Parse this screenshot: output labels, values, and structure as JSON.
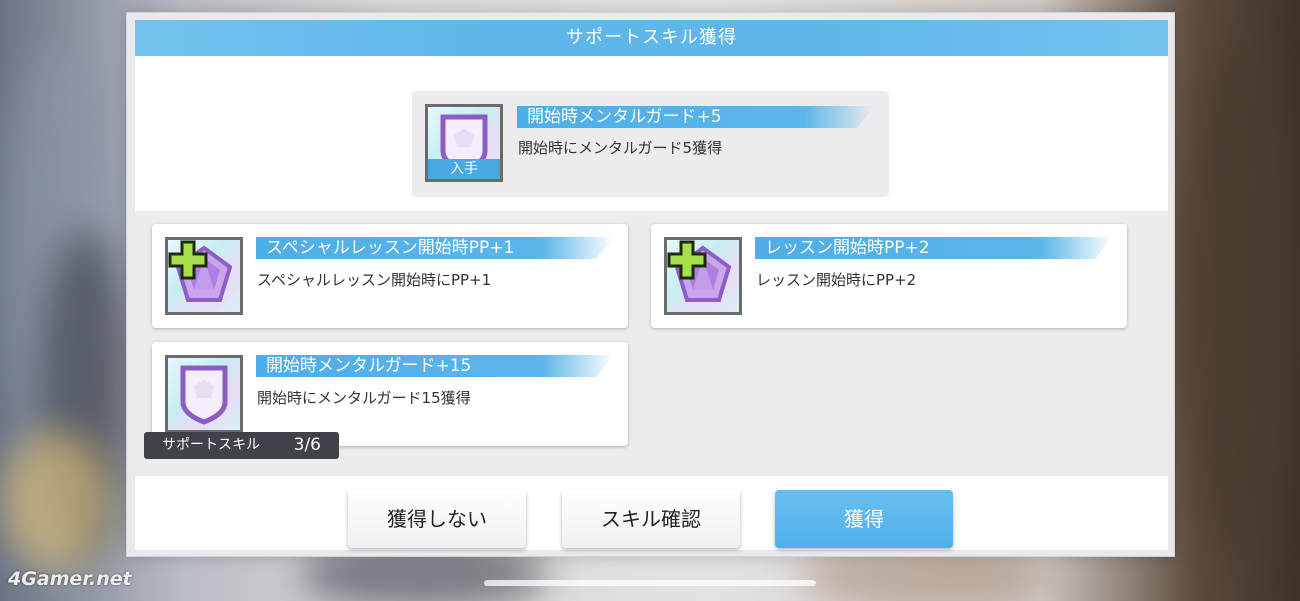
{
  "dialog": {
    "title": "サポートスキル獲得"
  },
  "acquired_skill": {
    "name": "開始時メンタルガード+5",
    "description": "開始時にメンタルガード5獲得",
    "tag": "入手",
    "icon": "shield-icon"
  },
  "skills": [
    {
      "name": "スペシャルレッスン開始時PP+1",
      "description": "スペシャルレッスン開始時にPP+1",
      "icon": "pentagon-gem-plus-icon"
    },
    {
      "name": "レッスン開始時PP+2",
      "description": "レッスン開始時にPP+2",
      "icon": "pentagon-gem-plus-icon"
    },
    {
      "name": "開始時メンタルガード+15",
      "description": "開始時にメンタルガード15獲得",
      "icon": "shield-icon"
    }
  ],
  "counter": {
    "label": "サポートスキル",
    "value": "3/6"
  },
  "buttons": {
    "decline": "獲得しない",
    "confirm": "スキル確認",
    "acquire": "獲得"
  },
  "watermark": "4Gamer.net",
  "colors": {
    "accent": "#5eb6ea",
    "primary_button": "#4fb0ea",
    "counter_bg": "#3f4248"
  }
}
